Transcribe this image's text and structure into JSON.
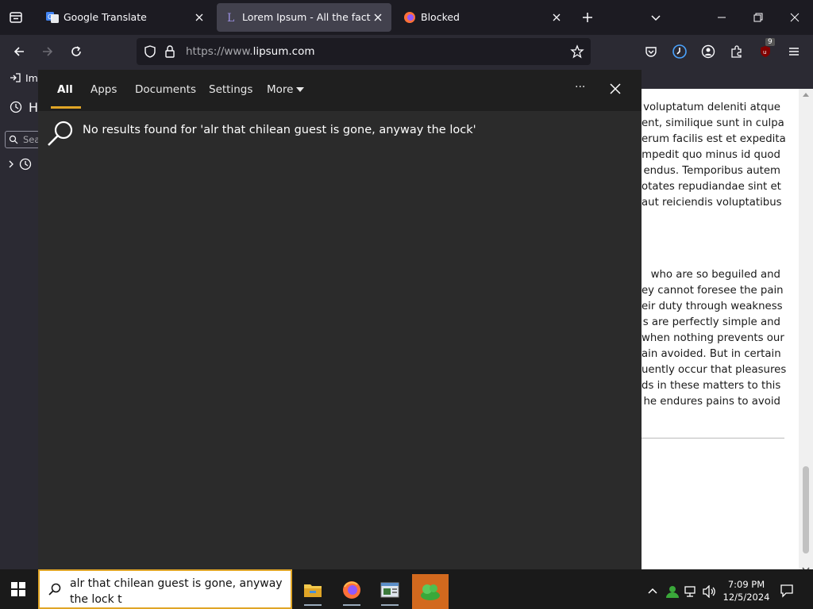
{
  "browser": {
    "tabs": [
      {
        "label": "Google Translate",
        "favicon": "google-translate-icon",
        "active": false
      },
      {
        "label": "Lorem Ipsum - All the facts - Li",
        "favicon": "lipsum-icon",
        "active": true
      },
      {
        "label": "Blocked",
        "favicon": "firefox-icon",
        "active": false
      }
    ],
    "url": {
      "protocol": "https://www.",
      "host": "lipsum.com"
    },
    "extension_badge": "9",
    "bookmarks": {
      "import_label": "Imp"
    },
    "sidebar": {
      "history_label": "H",
      "search_placeholder": "Sea"
    }
  },
  "page": {
    "paragraph1": [
      "voluptatum deleniti atque",
      "ent, similique sunt in culpa",
      "erum facilis est et expedita",
      "mpedit quo minus id quod",
      "endus. Temporibus autem",
      "otates repudiandae sint et",
      "aut reiciendis voluptatibus"
    ],
    "paragraph2": [
      "who are so beguiled and",
      "ey cannot foresee the pain",
      "eir duty through weakness",
      "s are perfectly simple and",
      "when nothing prevents our",
      "ain avoided. But in certain",
      "uently occur that pleasures",
      "ds in these matters to this",
      "he endures pains to avoid"
    ]
  },
  "search_panel": {
    "tabs": [
      "All",
      "Apps",
      "Documents",
      "Settings",
      "More"
    ],
    "more_options": "···",
    "no_results": "No results found for 'alr that chilean guest is gone, anyway the lock'"
  },
  "taskbar": {
    "search_text": "alr that chilean guest is gone, anyway the lock t",
    "apps": [
      "file-explorer-icon",
      "firefox-icon",
      "app-window-icon",
      "game-app-icon"
    ],
    "clock": {
      "time": "7:09 PM",
      "date": "12/5/2024"
    }
  },
  "colors": {
    "accent": "#e0a526",
    "panel": "#2b2b2b",
    "active_taskbar_app": "#d2691e"
  }
}
